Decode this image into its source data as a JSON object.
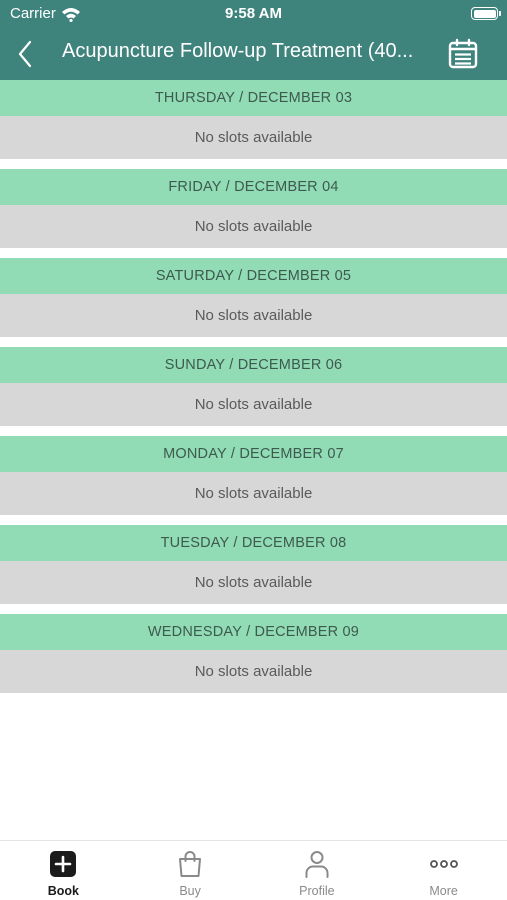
{
  "status_bar": {
    "carrier": "Carrier",
    "time": "9:58 AM",
    "icons": [
      "wifi-icon",
      "battery-icon"
    ]
  },
  "nav": {
    "title": "Acupuncture Follow-up Treatment (40...",
    "back_icon": "chevron-left-icon",
    "calendar_icon": "calendar-icon"
  },
  "days": [
    {
      "header": "THURSDAY / DECEMBER 03",
      "message": "No slots available"
    },
    {
      "header": "FRIDAY / DECEMBER 04",
      "message": "No slots available"
    },
    {
      "header": "SATURDAY / DECEMBER 05",
      "message": "No slots available"
    },
    {
      "header": "SUNDAY / DECEMBER 06",
      "message": "No slots available"
    },
    {
      "header": "MONDAY / DECEMBER 07",
      "message": "No slots available"
    },
    {
      "header": "TUESDAY / DECEMBER 08",
      "message": "No slots available"
    },
    {
      "header": "WEDNESDAY / DECEMBER 09",
      "message": "No slots available"
    }
  ],
  "tabs": [
    {
      "label": "Book",
      "icon": "plus-square-icon",
      "active": true
    },
    {
      "label": "Buy",
      "icon": "shopping-bag-icon",
      "active": false
    },
    {
      "label": "Profile",
      "icon": "person-icon",
      "active": false
    },
    {
      "label": "More",
      "icon": "more-dots-icon",
      "active": false
    }
  ],
  "colors": {
    "nav_background": "#3f837d",
    "day_header_background": "#91dbb5",
    "day_body_background": "#d7d7d7",
    "tab_active": "#1b1b1b",
    "tab_inactive": "#8a8a8a"
  }
}
